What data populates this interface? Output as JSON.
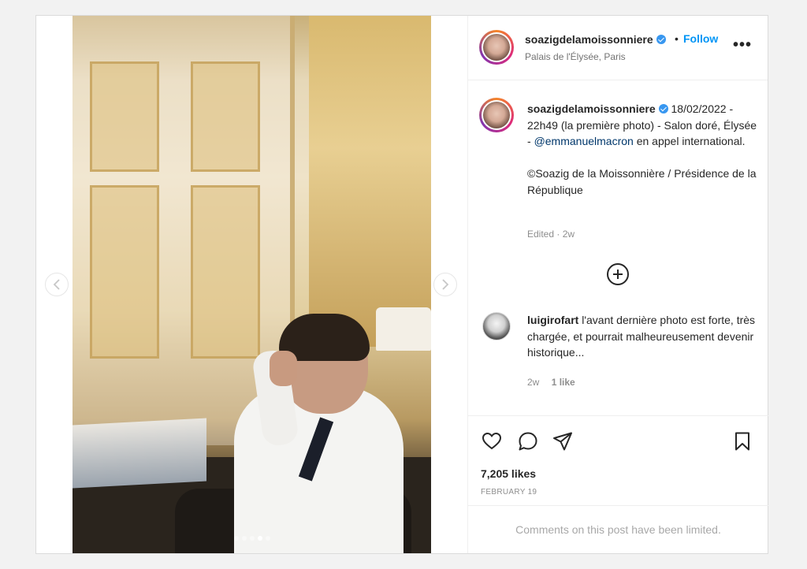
{
  "post": {
    "author": {
      "username": "soazigdelamoissonniere",
      "verified": true,
      "location": "Palais de l'Élysée, Paris",
      "follow_label": "Follow",
      "separator": "•"
    },
    "media": {
      "slide_count": 5,
      "active_slide": 4
    },
    "caption": {
      "username": "soazigdelamoissonniere",
      "text_before_mention": "18/02/2022 - 22h49 (la première photo) - Salon doré, Élysée - ",
      "mention": "@emmanuelmacron",
      "text_after_mention": " en appel international.",
      "credit": "©Soazig de la Moissonnière / Présidence de la République",
      "meta": "Edited · 2w"
    },
    "comments": [
      {
        "username": "luigirofart",
        "text": "l'avant dernière photo est forte, très chargée, et pourrait malheureusement devenir historique...",
        "time": "2w",
        "likes": "1 like"
      }
    ],
    "likes_count": "7,205 likes",
    "date": "FEBRUARY 19",
    "comments_limited": "Comments on this post have been limited.",
    "icons": [
      "like-heart-icon",
      "comment-bubble-icon",
      "share-paper-plane-icon",
      "save-bookmark-icon",
      "more-options-icon",
      "load-more-comments-icon",
      "chevron-left-icon",
      "chevron-right-icon",
      "verified-badge-icon"
    ],
    "colors": {
      "accent_blue": "#0095f6",
      "verified_blue": "#3897f0",
      "mention_blue": "#00376b",
      "muted_text": "#8e8e8e",
      "border": "#dbdbdb"
    }
  }
}
